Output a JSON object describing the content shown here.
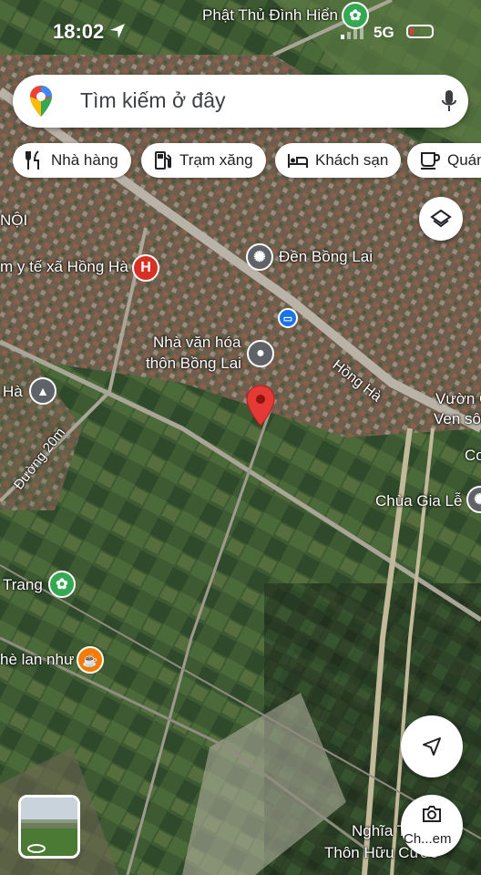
{
  "status_bar": {
    "time": "18:02",
    "network": "5G"
  },
  "search": {
    "placeholder": "Tìm kiếm ở đây"
  },
  "chips": [
    {
      "label": "Nhà hàng",
      "icon": "restaurant-icon"
    },
    {
      "label": "Trạm xăng",
      "icon": "gas-station-icon"
    },
    {
      "label": "Khách sạn",
      "icon": "hotel-icon"
    },
    {
      "label": "Quán",
      "icon": "cafe-icon"
    }
  ],
  "map_labels": {
    "top": "Phật Thủ Đình Hiển",
    "noi": "NỘI",
    "health": "m y tế xã Hồng Hà",
    "temple": "Đền Bồng Lai",
    "culture_line1": "Nhà văn hóa",
    "culture_line2": "thôn Bồng Lai",
    "road_hongha": "Hồng Hà",
    "road_20m": "Đường 20m",
    "left_ha": "Hà",
    "garden_line1": "Vườn C",
    "garden_line2": "Ven sôn",
    "co": "Cơ",
    "pagoda": "Chùa Gia Lễ",
    "trang": "Trang",
    "cafe": "hè lan như",
    "cemetery_line1": "Nghĩa T",
    "cemetery_line2": "Thôn Hữu Cước"
  },
  "fab": {
    "camera_label": "Ch...em"
  },
  "colors": {
    "accent_blue": "#1a73e8",
    "pin_red": "#e53935",
    "health_red": "#d93025",
    "poi_green": "#34a853",
    "poi_gray": "#5f6368",
    "cafe_orange": "#f57c00"
  }
}
